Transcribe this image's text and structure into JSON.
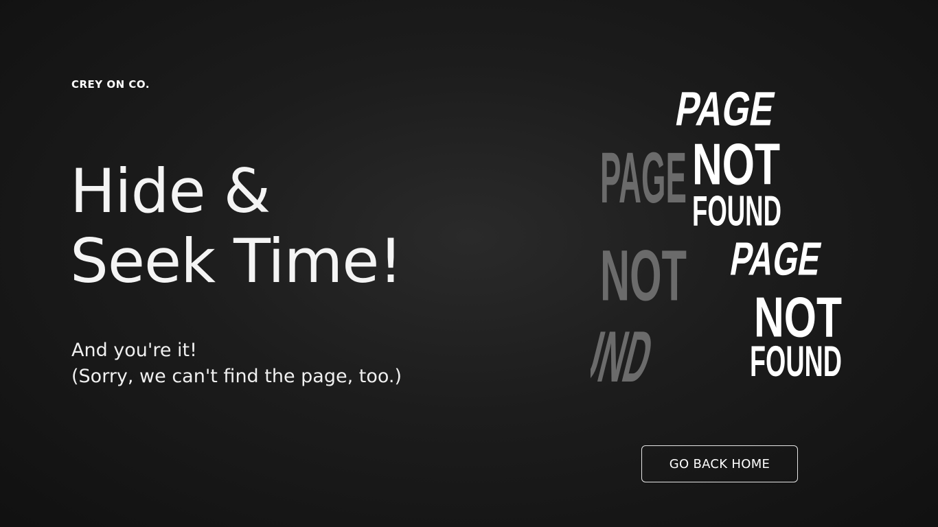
{
  "brand": "CREY ON CO.",
  "headline": {
    "line1": "Hide &",
    "line2": "Seek Time!"
  },
  "message": {
    "line1": "And you're it!",
    "line2": "(Sorry, we can't find the page, too.)"
  },
  "artwork": {
    "word1": "PAGE",
    "word2": "NOT",
    "word3": "FOUND",
    "color_back": "#6b6b6b",
    "color_front": "#ffffff"
  },
  "button": {
    "label": "GO BACK HOME"
  }
}
